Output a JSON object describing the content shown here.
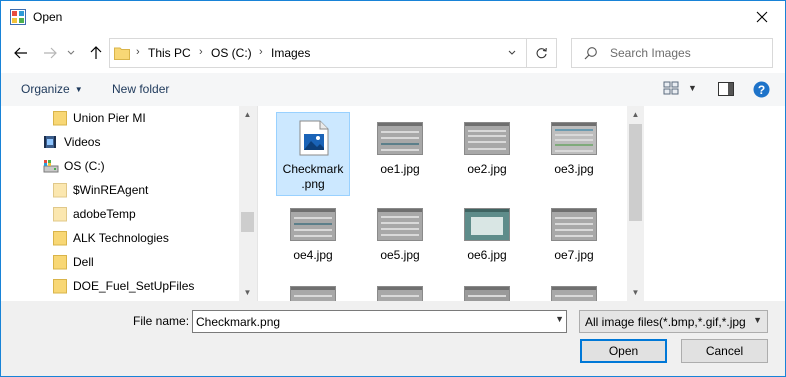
{
  "window": {
    "title": "Open"
  },
  "address": {
    "crumbs": [
      "This PC",
      "OS (C:)",
      "Images"
    ]
  },
  "search": {
    "placeholder": "Search Images"
  },
  "toolbar": {
    "organize_label": "Organize",
    "new_folder_label": "New folder"
  },
  "tree": {
    "items": [
      {
        "label": "Union Pier MI",
        "icon": "folder-icon"
      },
      {
        "label": "Videos",
        "icon": "videos-icon"
      },
      {
        "label": "OS (C:)",
        "icon": "drive-icon"
      },
      {
        "label": "$WinREAgent",
        "icon": "folder-icon"
      },
      {
        "label": "adobeTemp",
        "icon": "folder-icon"
      },
      {
        "label": "ALK Technologies",
        "icon": "folder-icon"
      },
      {
        "label": "Dell",
        "icon": "folder-icon"
      },
      {
        "label": "DOE_Fuel_SetUpFiles",
        "icon": "folder-icon"
      }
    ]
  },
  "files": [
    {
      "label": "Checkmark.png",
      "line1": "Checkmark",
      "line2": ".png",
      "selected": true
    },
    {
      "label": "oe1.jpg"
    },
    {
      "label": "oe2.jpg"
    },
    {
      "label": "oe3.jpg"
    },
    {
      "label": "oe4.jpg"
    },
    {
      "label": "oe5.jpg"
    },
    {
      "label": "oe6.jpg"
    },
    {
      "label": "oe7.jpg"
    }
  ],
  "footer": {
    "file_name_label": "File name:",
    "file_name_value": "Checkmark.png",
    "file_type_value": "All image files(*.bmp,*.gif,*.jpg",
    "open_label": "Open",
    "cancel_label": "Cancel"
  },
  "colors": {
    "accent": "#0078d7",
    "folder": "#f8d775",
    "selection": "#cce8ff"
  }
}
